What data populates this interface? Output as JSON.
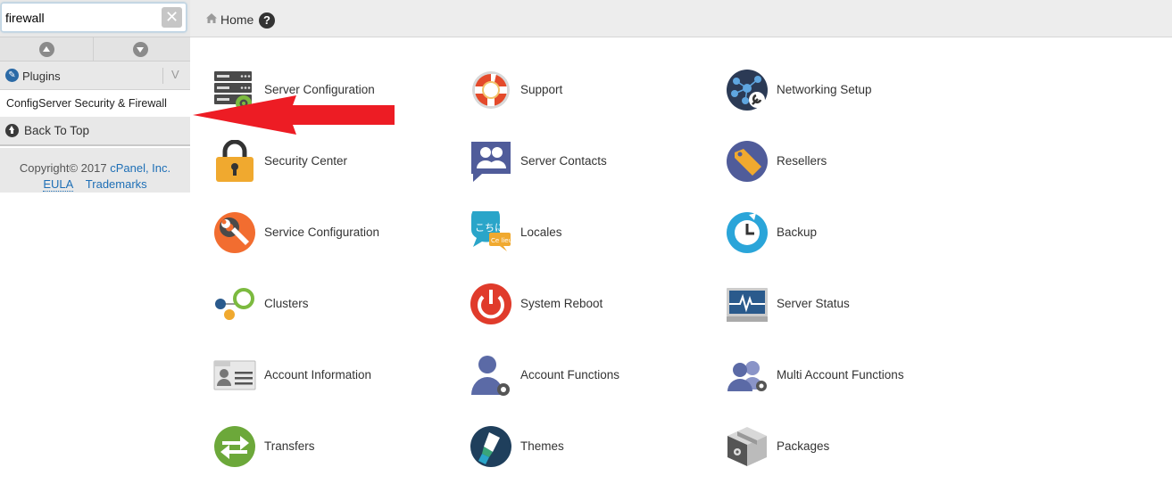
{
  "sidebar": {
    "search_value": "firewall",
    "section_title": "Plugins",
    "plugin_items": [
      "ConfigServer Security & Firewall"
    ],
    "back_to_top": "Back To Top",
    "copyright_prefix": "Copyright© 2017 ",
    "copyright_company": "cPanel, Inc.",
    "eula": "EULA",
    "trademarks": "Trademarks"
  },
  "topbar": {
    "home": "Home",
    "help": "?"
  },
  "tools": [
    {
      "label": "Server Configuration",
      "icon": "server-config-icon"
    },
    {
      "label": "Support",
      "icon": "lifebuoy-icon"
    },
    {
      "label": "Networking Setup",
      "icon": "network-icon"
    },
    {
      "label": "Security Center",
      "icon": "padlock-icon"
    },
    {
      "label": "Server Contacts",
      "icon": "contacts-icon"
    },
    {
      "label": "Resellers",
      "icon": "tag-icon"
    },
    {
      "label": "Service Configuration",
      "icon": "wrench-gear-icon"
    },
    {
      "label": "Locales",
      "icon": "speech-bubbles-icon"
    },
    {
      "label": "Backup",
      "icon": "backup-clock-icon"
    },
    {
      "label": "Clusters",
      "icon": "clusters-icon"
    },
    {
      "label": "System Reboot",
      "icon": "power-icon"
    },
    {
      "label": "Server Status",
      "icon": "monitor-pulse-icon"
    },
    {
      "label": "Account Information",
      "icon": "id-card-icon"
    },
    {
      "label": "Account Functions",
      "icon": "user-gear-icon"
    },
    {
      "label": "Multi Account Functions",
      "icon": "users-gear-icon"
    },
    {
      "label": "Transfers",
      "icon": "transfer-arrows-icon"
    },
    {
      "label": "Themes",
      "icon": "paint-brush-icon"
    },
    {
      "label": "Packages",
      "icon": "package-box-icon"
    }
  ],
  "colors": {
    "accent_blue": "#1e6fb6",
    "annotation_red": "#ed1c24"
  }
}
